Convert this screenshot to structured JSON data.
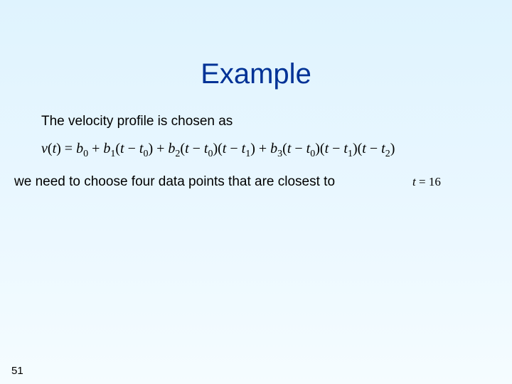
{
  "title": "Example",
  "line1": "The velocity profile is chosen as",
  "formula": {
    "lhs": "v",
    "var": "t",
    "b0": "b",
    "b0sub": "0",
    "b1": "b",
    "b1sub": "1",
    "t0": "t",
    "t0sub": "0",
    "b2": "b",
    "b2sub": "2",
    "t1": "t",
    "t1sub": "1",
    "b3": "b",
    "b3sub": "3",
    "t2": "t",
    "t2sub": "2"
  },
  "line2": "we need to choose four data points that are closest to",
  "condition": {
    "var": "t",
    "op": "=",
    "val": "16"
  },
  "page": "51"
}
